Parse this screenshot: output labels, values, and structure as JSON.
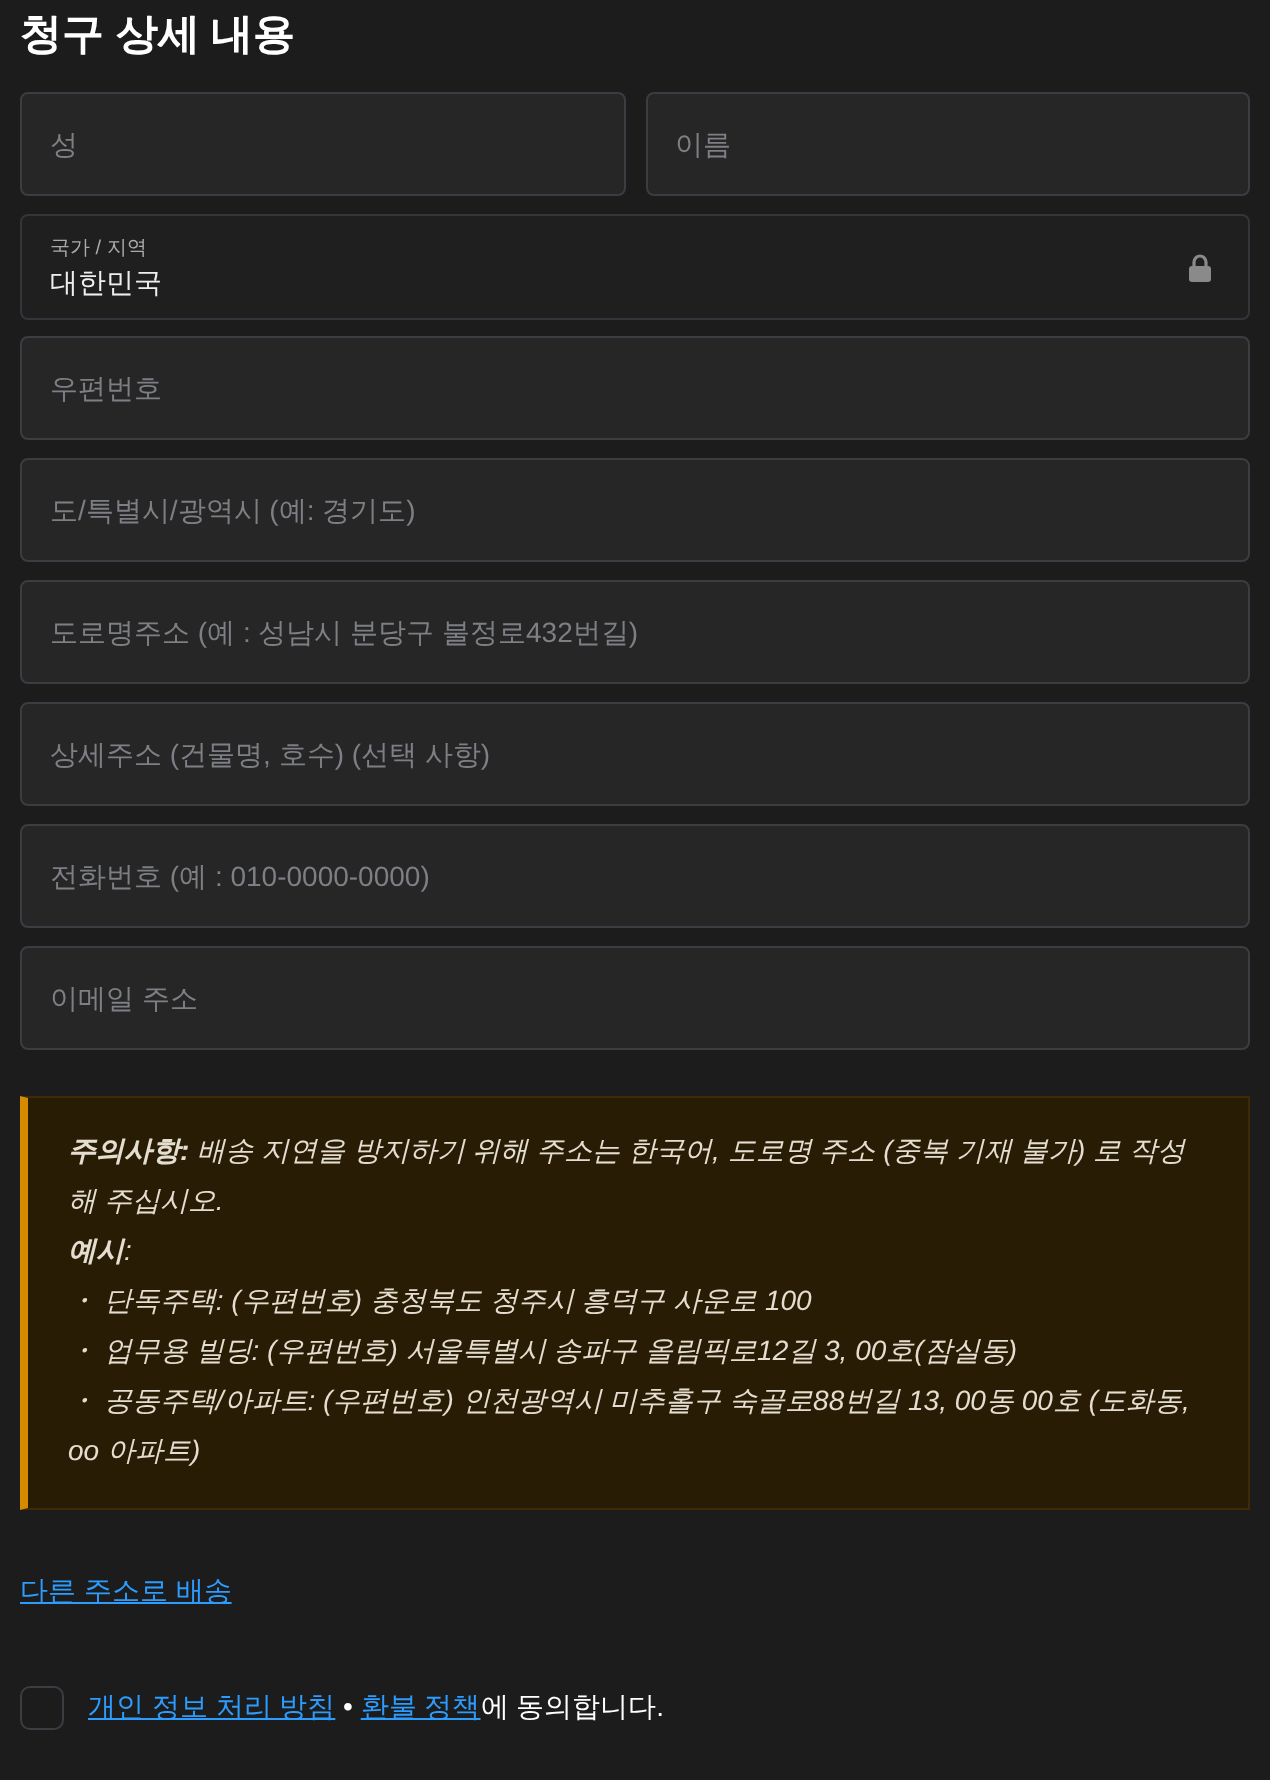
{
  "title": "청구 상세 내용",
  "name_fields": [
    {
      "placeholder": "성"
    },
    {
      "placeholder": "이름"
    }
  ],
  "country": {
    "label": "국가 / 지역",
    "value": "대한민국",
    "locked": true
  },
  "fields": [
    {
      "placeholder": "우편번호"
    },
    {
      "placeholder": "도/특별시/광역시 (예: 경기도)"
    },
    {
      "placeholder": "도로명주소 (예 : 성남시 분당구 불정로432번길)"
    },
    {
      "placeholder": "상세주소 (건물명, 호수) (선택 사항)"
    },
    {
      "placeholder": "전화번호 (예 : 010-0000-0000)"
    },
    {
      "placeholder": "이메일 주소"
    }
  ],
  "notice": {
    "lines": [
      "**주의사항:** 배송 지연을 방지하기 위해 주소는 한국어, 도로명 주소 (중복 기재 불가) 로 작성해 주십시오.",
      "**예시**:",
      "・ 단독주택: (우편번호) 충청북도 청주시 흥덕구 사운로 100",
      "・ 업무용 빌딩: (우편번호) 서울특별시 송파구 올림픽로12길 3, 00호(잠실동)",
      "・ 공동주택/아파트: (우편번호) 인천광역시 미추홀구 숙골로88번길 13, 00동 00호 (도화동, oo 아파트)"
    ]
  },
  "ship_link": "다른 주소로 배송",
  "consent": {
    "checked": false,
    "privacy_link": "개인 정보 처리 방침",
    "separator": " • ",
    "refund_link": "환불 정책",
    "suffix": "에 동의합니다."
  }
}
